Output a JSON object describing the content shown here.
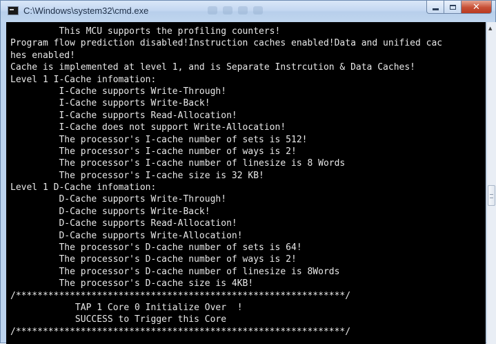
{
  "window": {
    "title": "C:\\Windows\\system32\\cmd.exe",
    "icon": "console-icon",
    "controls": {
      "minimize_icon": "minimize-icon",
      "maximize_icon": "maximize-icon",
      "close_label": "✕"
    }
  },
  "colors": {
    "titlebar": "#c5d8f1",
    "console_bg": "#000000",
    "console_text": "#e8e8e8",
    "close_button": "#c74f35"
  },
  "console": {
    "lines": [
      "         This MCU supports the profiling counters!",
      "Program flow prediction disabled!Instruction caches enabled!Data and unified cac",
      "hes enabled!",
      "Cache is implemented at level 1, and is Separate Instrcution & Data Caches!",
      "Level 1 I-Cache infomation:",
      "         I-Cache supports Write-Through!",
      "         I-Cache supports Write-Back!",
      "         I-Cache supports Read-Allocation!",
      "         I-Cache does not support Write-Allocation!",
      "         The processor's I-cache number of sets is 512!",
      "         The processor's I-cache number of ways is 2!",
      "         The processor's I-cache number of linesize is 8 Words",
      "         The processor's I-cache size is 32 KB!",
      "Level 1 D-Cache infomation:",
      "         D-Cache supports Write-Through!",
      "         D-Cache supports Write-Back!",
      "         D-Cache supports Read-Allocation!",
      "         D-Cache supports Write-Allocation!",
      "         The processor's D-cache number of sets is 64!",
      "         The processor's D-cache number of ways is 2!",
      "         The processor's D-cache number of linesize is 8Words",
      "         The processor's D-cache size is 4KB!",
      "/*************************************************************/",
      "            TAP 1 Core 0 Initialize Over  !",
      "            SUCCESS to Trigger this Core",
      "/*************************************************************/"
    ]
  },
  "scrollbar": {
    "up_arrow": "▲",
    "thumb_icon": "scroll-grip-icon"
  }
}
